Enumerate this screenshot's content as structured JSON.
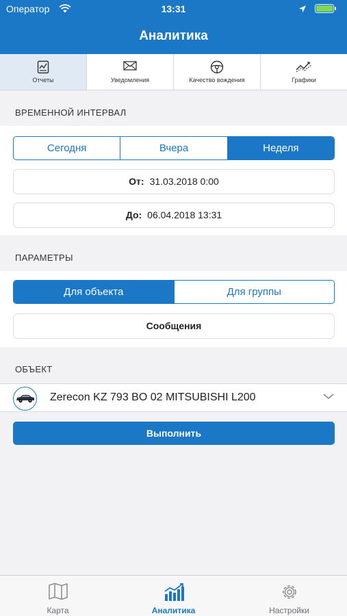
{
  "status_bar": {
    "carrier": "Оператор",
    "time": "13:31"
  },
  "header": {
    "title": "Аналитика"
  },
  "top_tabs": [
    {
      "label": "Отчеты",
      "icon": "report-icon",
      "active": true
    },
    {
      "label": "Уведомления",
      "icon": "envelope-icon",
      "active": false
    },
    {
      "label": "Качество вождения",
      "icon": "steering-wheel-icon",
      "active": false
    },
    {
      "label": "Графики",
      "icon": "line-chart-icon",
      "active": false
    }
  ],
  "time_interval": {
    "section_title": "ВРЕМЕННОЙ ИНТЕРВАЛ",
    "segments": [
      "Сегодня",
      "Вчера",
      "Неделя"
    ],
    "selected": "Неделя",
    "from_label": "От:",
    "from_value": "31.03.2018 0:00",
    "to_label": "До:",
    "to_value": "06.04.2018 13:31"
  },
  "parameters": {
    "section_title": "ПАРАМЕТРЫ",
    "segments": [
      "Для объекта",
      "Для группы"
    ],
    "selected": "Для объекта",
    "report_type": "Сообщения"
  },
  "object": {
    "section_title": "ОБЪЕКТ",
    "name": "Zerecon KZ 793 BO 02 MITSUBISHI L200",
    "icon": "car-icon"
  },
  "run_button": {
    "label": "Выполнить"
  },
  "bottom_tabs": [
    {
      "label": "Карта",
      "icon": "map-icon",
      "active": false
    },
    {
      "label": "Аналитика",
      "icon": "bar-chart-icon",
      "active": true
    },
    {
      "label": "Настройки",
      "icon": "gear-icon",
      "active": false
    }
  ],
  "colors": {
    "accent": "#1a78c6",
    "background": "#f2f2f5",
    "active_tab_bg": "#dfeaf5",
    "battery": "#7ed957"
  }
}
